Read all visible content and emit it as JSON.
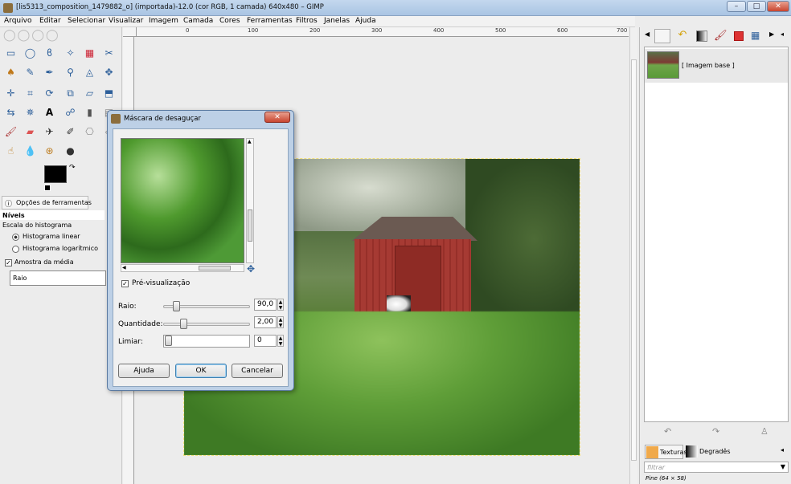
{
  "window": {
    "title": "[lis5313_composition_1479882_o] (importada)-12.0 (cor RGB, 1 camada) 640x480 – GIMP",
    "minimize": "–",
    "maximize": "□",
    "close": "✕"
  },
  "menu": [
    "Arquivo",
    "Editar",
    "Selecionar",
    "Visualizar",
    "Imagem",
    "Camada",
    "Cores",
    "Ferramentas",
    "Filtros",
    "Janelas",
    "Ajuda"
  ],
  "ruler": [
    "0",
    "100",
    "200",
    "300",
    "400",
    "500",
    "600",
    "700"
  ],
  "tool_options": {
    "tab_label": "Opções de ferramentas",
    "section": "Níveis",
    "scale_label": "Escala do histograma",
    "linear": "Histograma linear",
    "log": "Histograma logarítmico",
    "sample_average": "Amostra da média",
    "radius_field": "Raio"
  },
  "layers": {
    "item_label": "[ Imagem base ]"
  },
  "brushes": {
    "tab_textures": "Texturas",
    "tab_gradients": "Degradês",
    "filter_placeholder": "filtrar",
    "current": "Pine (64 × 58)"
  },
  "dialog": {
    "title": "Máscara de desaguçar",
    "preview_label": "Pré-visualização",
    "radius_label": "Raio:",
    "radius_value": "90,0",
    "radius_level": 0.11,
    "amount_label": "Quantidade:",
    "amount_value": "2,00",
    "amount_level": 0.2,
    "threshold_label": "Limiar:",
    "threshold_value": "0",
    "threshold_level": 0.0,
    "help_button": "Ajuda",
    "ok_button": "OK",
    "cancel_button": "Cancelar"
  }
}
